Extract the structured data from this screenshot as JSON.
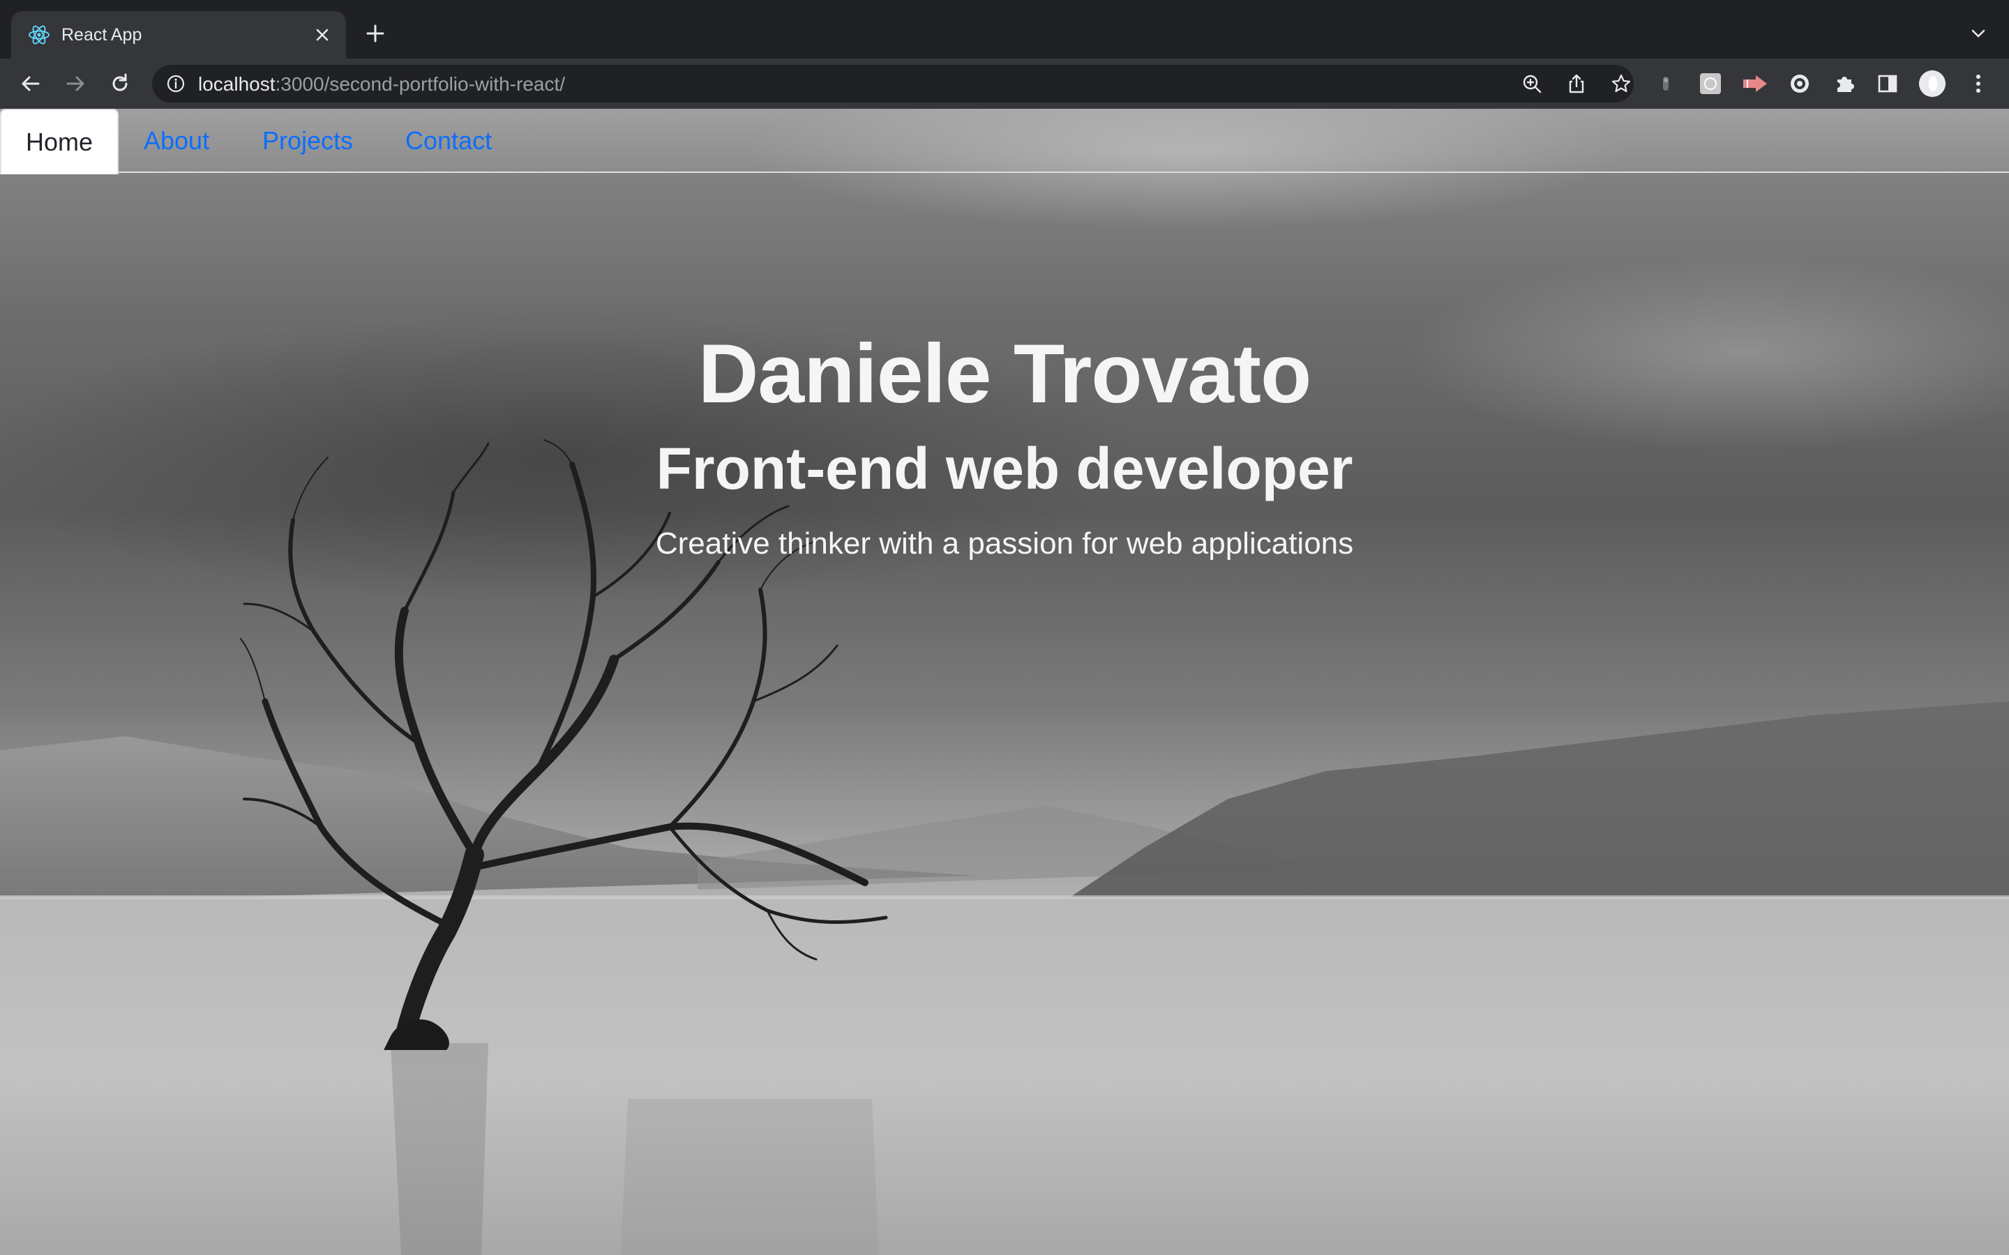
{
  "browser": {
    "tab": {
      "title": "React App",
      "favicon": "react-logo-icon"
    },
    "new_tab_icon": "plus-icon",
    "tab_search_icon": "chevron-down-icon",
    "nav": {
      "back_icon": "back-arrow-icon",
      "forward_icon": "forward-arrow-icon",
      "reload_icon": "reload-icon"
    },
    "omnibox": {
      "info_icon": "info-icon",
      "url_host": "localhost",
      "url_rest": ":3000/second-portfolio-with-react/",
      "zoom_icon": "zoom-icon",
      "share_icon": "share-icon",
      "bookmark_icon": "star-icon"
    },
    "extensions": [
      "extension-gray-icon",
      "extension-square-icon",
      "extension-red-arrow-icon",
      "extension-globe-icon",
      "puzzle-icon",
      "sidepanel-icon",
      "profile-avatar",
      "kebab-menu-icon"
    ]
  },
  "page": {
    "nav": {
      "items": [
        {
          "label": "Home",
          "active": true
        },
        {
          "label": "About",
          "active": false
        },
        {
          "label": "Projects",
          "active": false
        },
        {
          "label": "Contact",
          "active": false
        }
      ]
    },
    "hero": {
      "name": "Daniele Trovato",
      "role": "Front-end web developer",
      "tagline": "Creative thinker with a passion for web applications"
    },
    "colors": {
      "link": "#0d6efd",
      "active_tab_text": "#212529",
      "hero_text": "#f5f5f5"
    }
  }
}
